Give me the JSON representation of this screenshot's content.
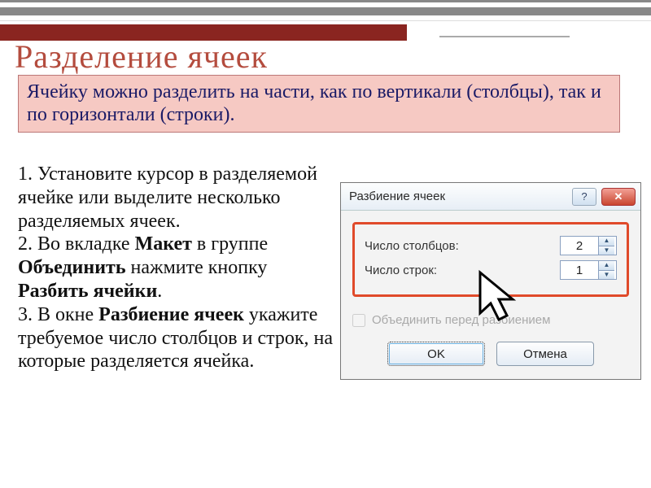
{
  "title": "Разделение ячеек",
  "infobox": "Ячейку можно разделить на части, как по вертикали (столбцы), так и по горизонтали (строки).",
  "steps": {
    "s1a": "1. Установите курсор в разделяемой ячейке или выделите несколько разделяемых ячеек.",
    "s2a": "2. Во вкладке ",
    "s2_b1": "Макет",
    "s2b": " в группе ",
    "s2_b2": "Объединить",
    "s2c": " нажмите кнопку ",
    "s2_b3": "Разбить ячейки",
    "s2d": ".",
    "s3a": "3. В окне ",
    "s3_b1": "Разбиение ячеек",
    "s3b": "  укажите требуемое число столбцов и строк, на которые разделяется ячейка."
  },
  "dialog": {
    "title": "Разбиение ячеек",
    "help_glyph": "?",
    "close_glyph": "✕",
    "cols_label": "Число столбцов:",
    "rows_label": "Число строк:",
    "cols_value": "2",
    "rows_value": "1",
    "up_glyph": "▲",
    "down_glyph": "▼",
    "merge_label": "Объединить перед разбиением",
    "ok": "OK",
    "cancel": "Отмена"
  }
}
